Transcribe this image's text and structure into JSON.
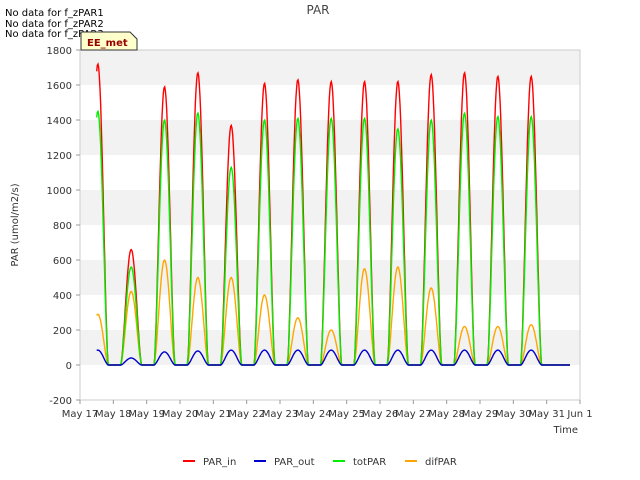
{
  "notes": [
    "No data for f_zPAR1",
    "No data for f_zPAR2",
    "No data for f_zPAR3"
  ],
  "chart_data": {
    "type": "line",
    "title": "PAR",
    "xlabel": "Time",
    "ylabel": "PAR (umol/m2/s)",
    "ylim": [
      -200,
      1800
    ],
    "yticks": [
      -200,
      0,
      200,
      400,
      600,
      800,
      1000,
      1200,
      1400,
      1600,
      1800
    ],
    "xlim": [
      "May 17",
      "Jun 1"
    ],
    "xticks": [
      "May 17",
      "May 18",
      "May 19",
      "May 20",
      "May 21",
      "May 22",
      "May 23",
      "May 24",
      "May 25",
      "May 26",
      "May 27",
      "May 28",
      "May 29",
      "May 30",
      "May 31",
      "Jun 1"
    ],
    "grid": "horizontal bands",
    "station_label": "EE_met",
    "legend_position": "bottom-center",
    "series_colors": {
      "PAR_in": "#ff0000",
      "PAR_out": "#0000cc",
      "totPAR": "#00ee00",
      "difPAR": "#ffa500"
    },
    "series": [
      {
        "name": "PAR_in",
        "daily_peak": [
          1720,
          660,
          1590,
          1670,
          1370,
          1610,
          1630,
          1620,
          1620,
          1620,
          1660,
          1670,
          1650,
          1650
        ]
      },
      {
        "name": "PAR_out",
        "daily_peak": [
          85,
          40,
          75,
          80,
          85,
          85,
          85,
          85,
          85,
          85,
          85,
          85,
          85,
          85
        ]
      },
      {
        "name": "totPAR",
        "daily_peak": [
          1450,
          560,
          1400,
          1440,
          1130,
          1400,
          1410,
          1410,
          1410,
          1350,
          1400,
          1440,
          1420,
          1420
        ]
      },
      {
        "name": "difPAR",
        "daily_peak": [
          290,
          420,
          600,
          500,
          500,
          400,
          270,
          200,
          550,
          560,
          440,
          220,
          220,
          230
        ]
      }
    ]
  }
}
